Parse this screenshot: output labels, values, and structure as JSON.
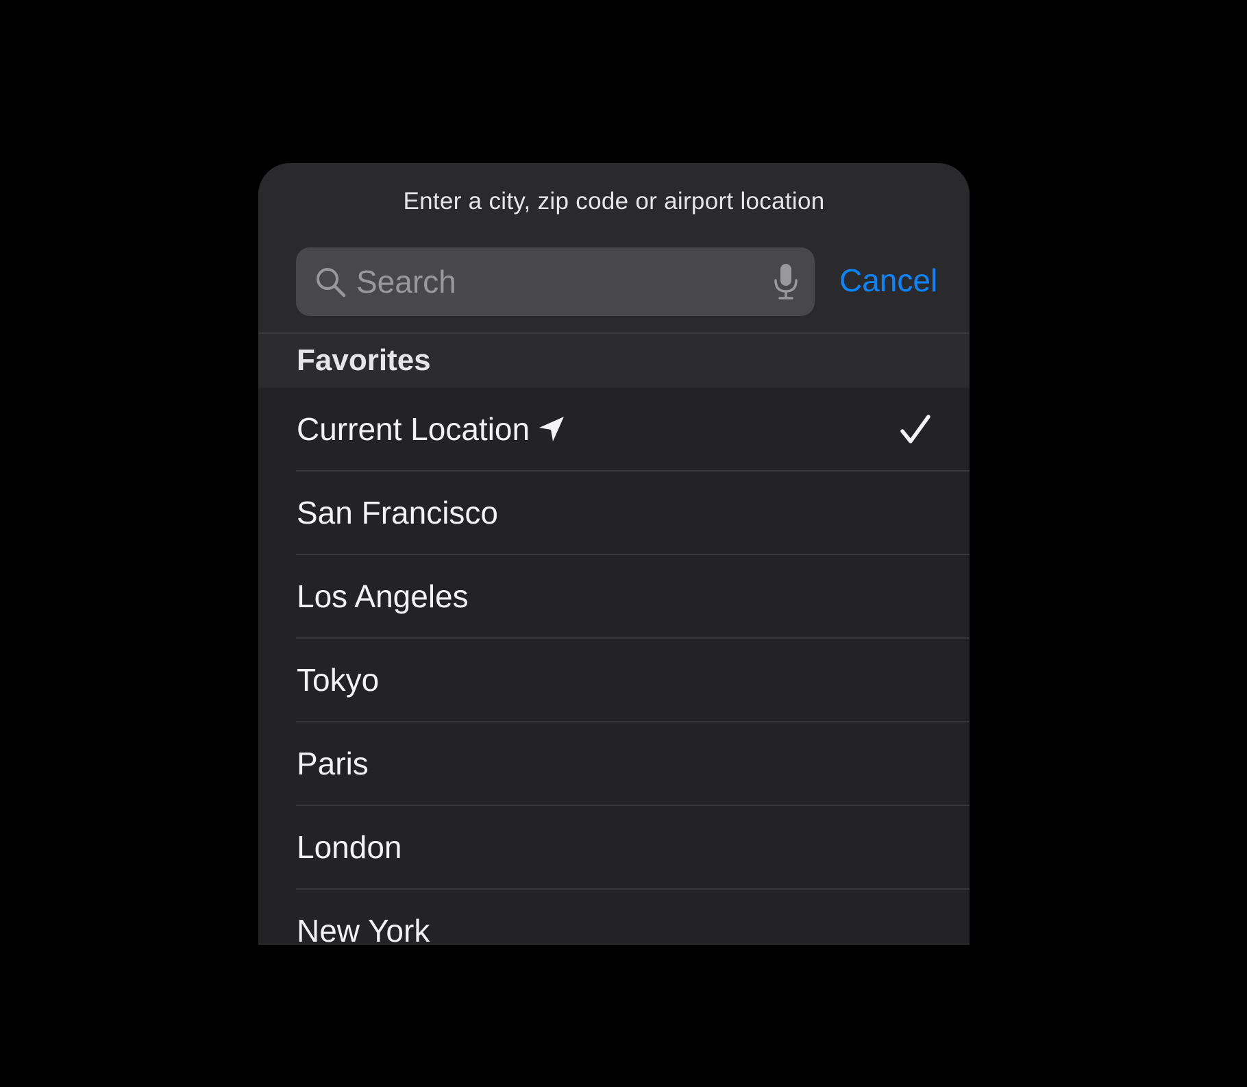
{
  "dialog": {
    "prompt": "Enter a city, zip code or airport location"
  },
  "search": {
    "placeholder": "Search",
    "cancel_label": "Cancel"
  },
  "favorites": {
    "title": "Favorites",
    "items": [
      {
        "label": "Current Location",
        "icon": "location-arrow-icon",
        "selected": true
      },
      {
        "label": "San Francisco"
      },
      {
        "label": "Los Angeles"
      },
      {
        "label": "Tokyo"
      },
      {
        "label": "Paris"
      },
      {
        "label": "London"
      },
      {
        "label": "New York"
      }
    ]
  },
  "colors": {
    "accent": "#0a84ff",
    "background": "#000000",
    "panel": "#232325"
  }
}
